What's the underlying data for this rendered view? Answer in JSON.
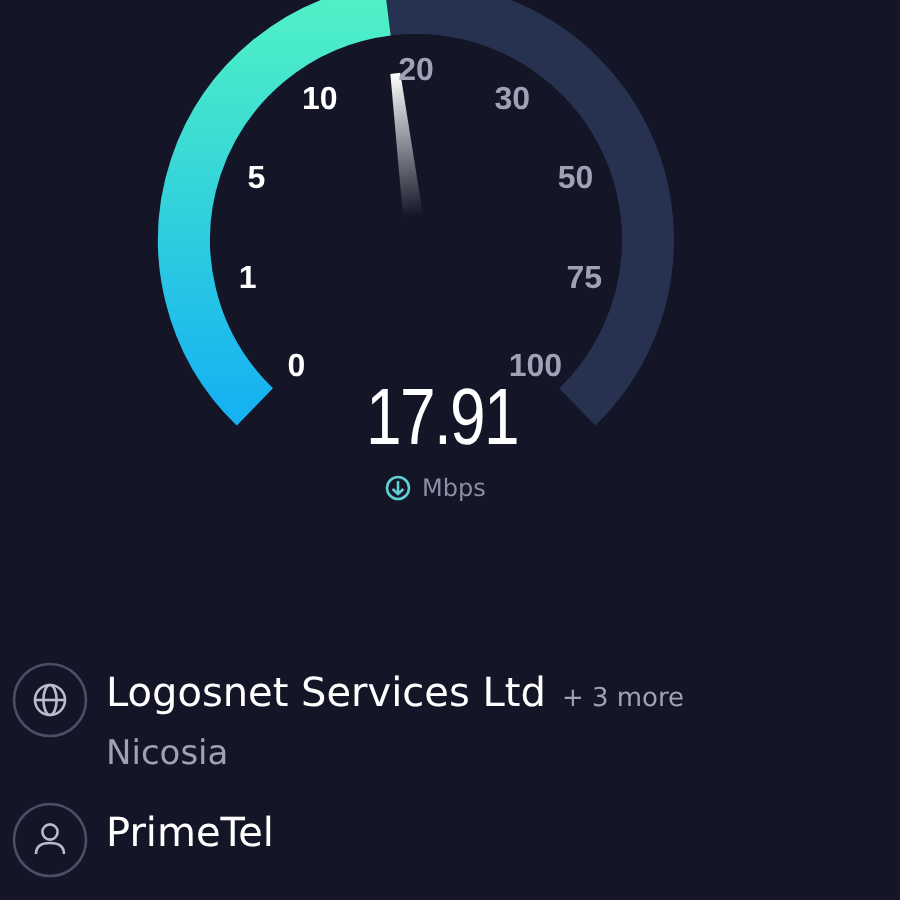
{
  "gauge": {
    "ticks": [
      "0",
      "1",
      "5",
      "10",
      "20",
      "30",
      "50",
      "75",
      "100"
    ],
    "value": "17.91",
    "unit": "Mbps"
  },
  "provider": {
    "name": "Logosnet Services Ltd",
    "extra": "+ 3 more",
    "location": "Nicosia"
  },
  "host": {
    "name": "PrimeTel"
  }
}
